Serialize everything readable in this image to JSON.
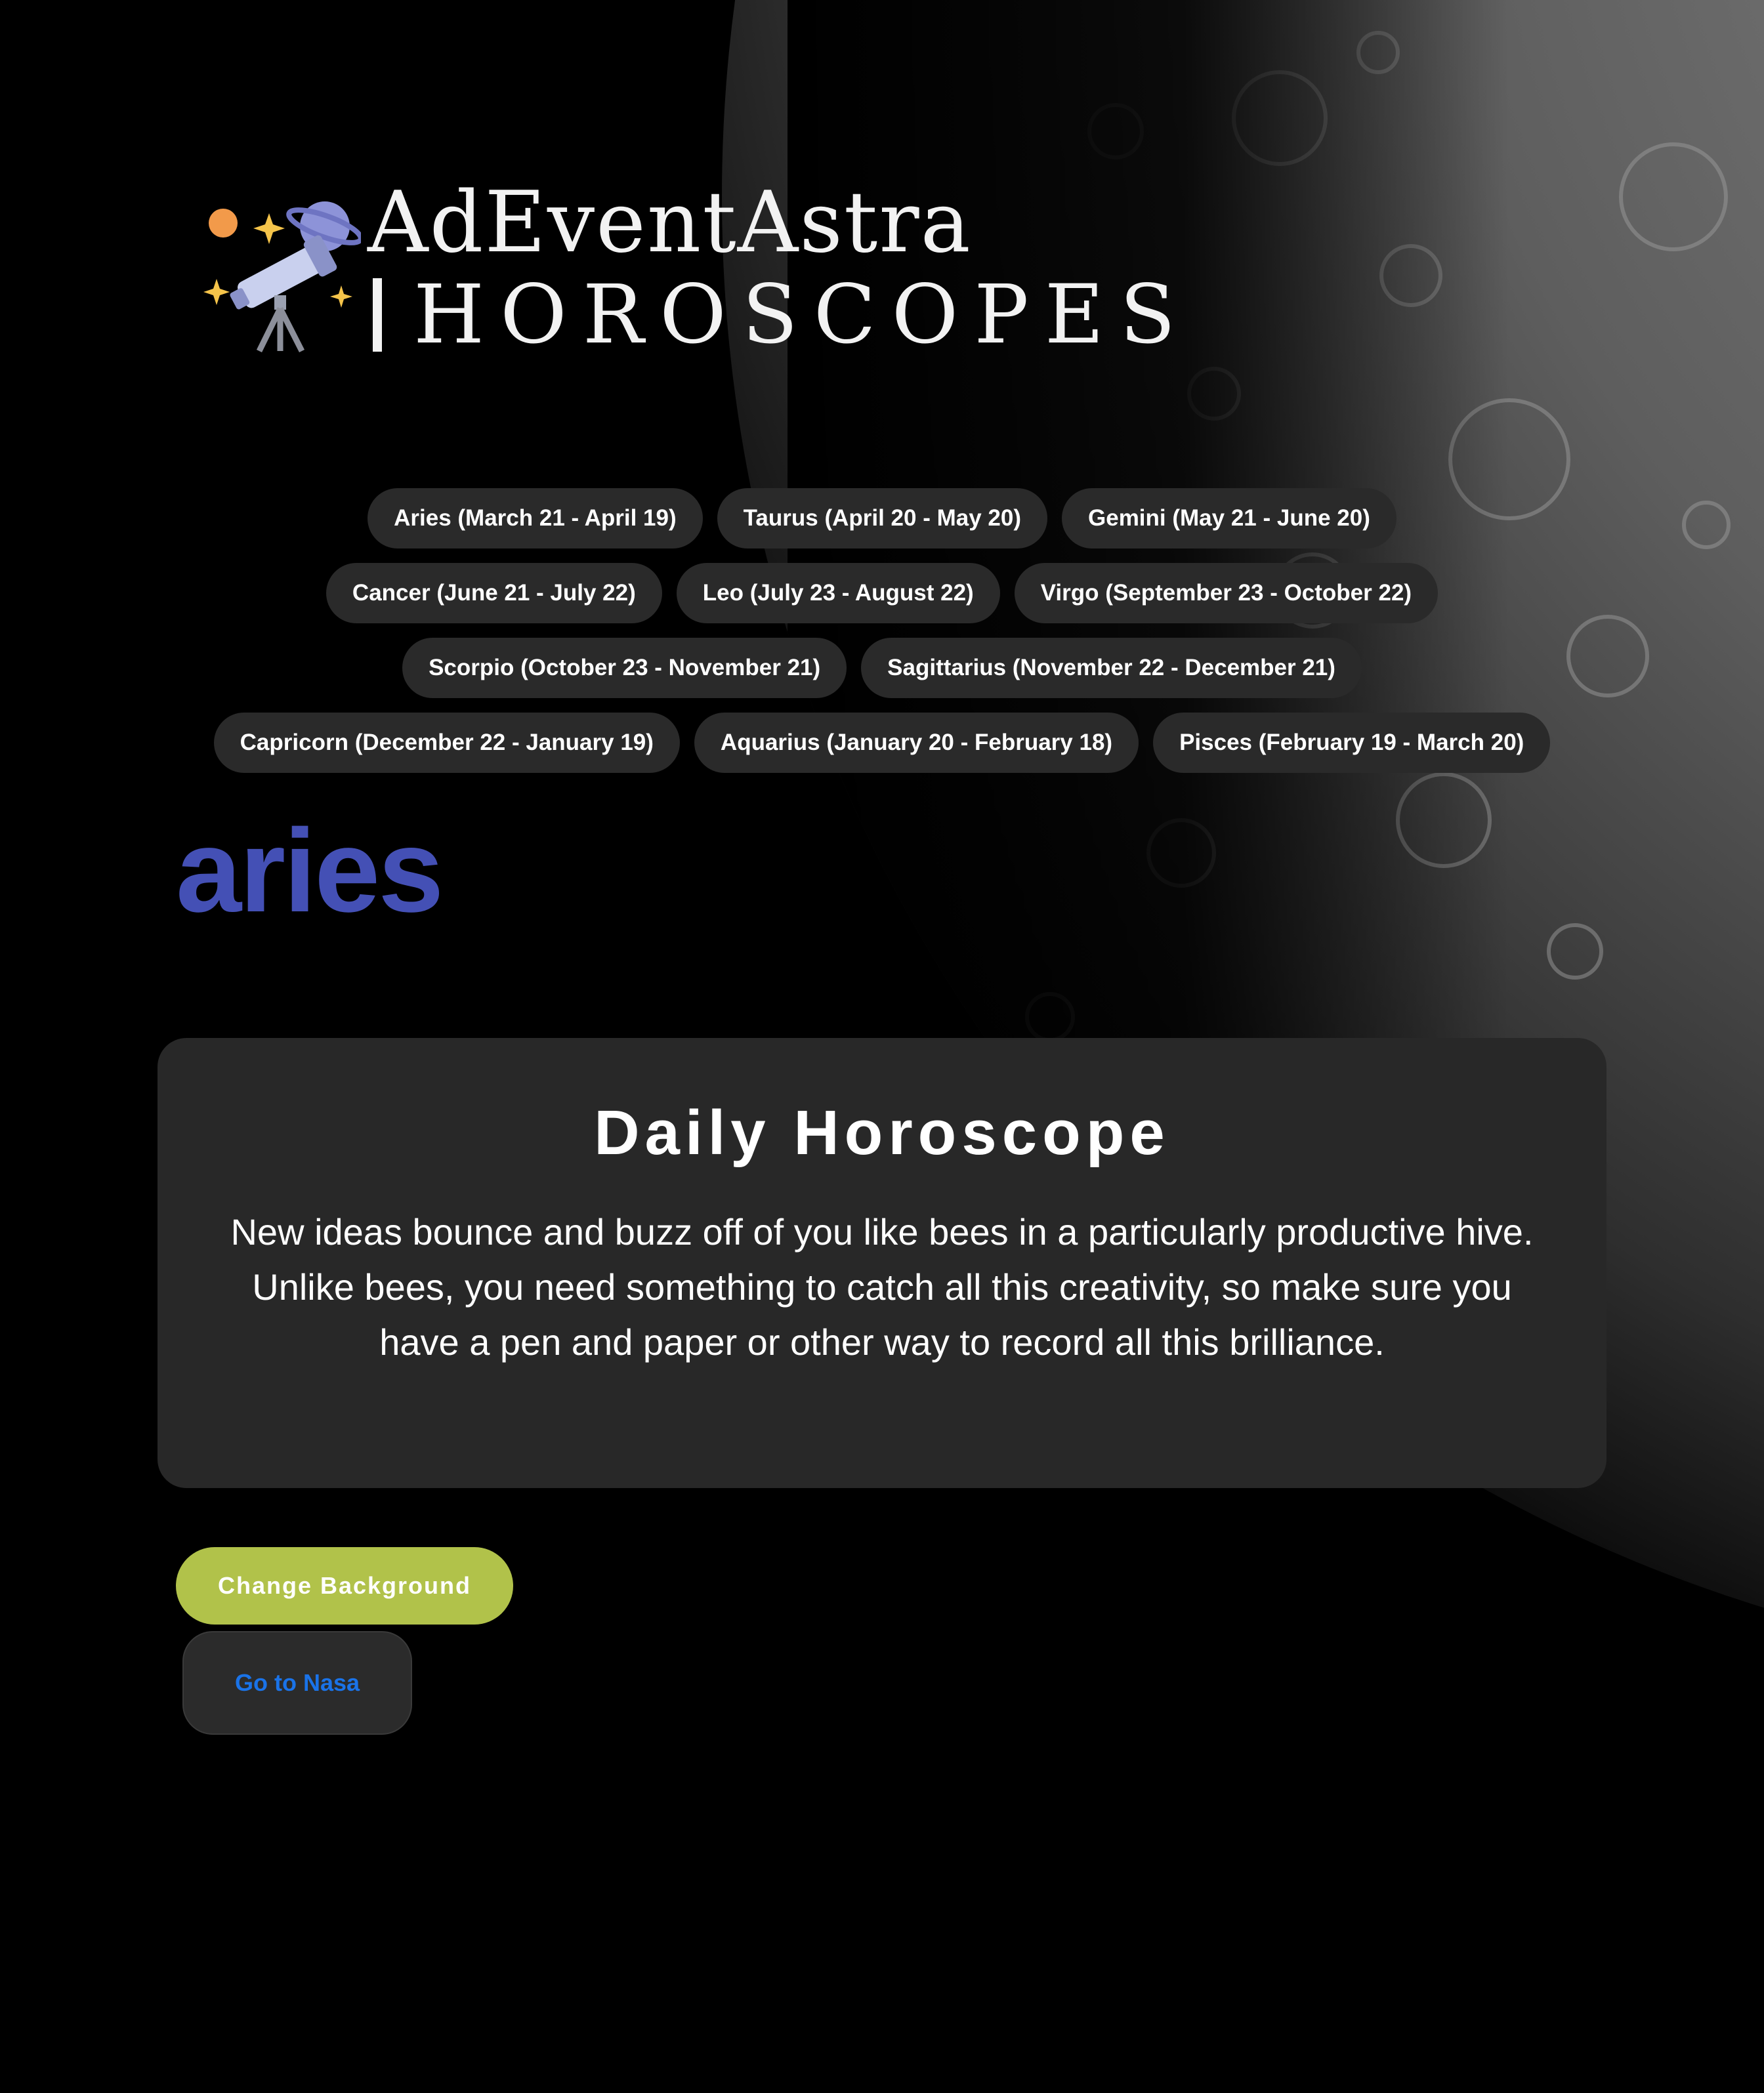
{
  "header": {
    "brand_name": "AdEventAstra",
    "brand_subtitle": "HOROSCOPES",
    "logo_icon": "telescope-icon"
  },
  "zodiac_signs": [
    [
      "Aries (March 21 - April 19)",
      "Taurus (April 20 - May 20)",
      "Gemini (May 21 - June 20)"
    ],
    [
      "Cancer (June 21 - July 22)",
      "Leo (July 23 - August 22)",
      "Virgo (September 23 - October 22)"
    ],
    [
      "Scorpio (October 23 - November 21)",
      "Sagittarius (November 22 - December 21)"
    ],
    [
      "Capricorn (December 22 - January 19)",
      "Aquarius (January 20 - February 18)",
      "Pisces (February 19 - March 20)"
    ]
  ],
  "selected_sign": "aries",
  "horoscope": {
    "title": "Daily Horoscope",
    "text": "New ideas bounce and buzz off of you like bees in a particularly productive hive. Unlike bees, you need something to catch all this creativity, so make sure you have a pen and paper or other way to record all this brilliance."
  },
  "buttons": {
    "change_background": "Change Background",
    "go_to_nasa": "Go to Nasa"
  },
  "colors": {
    "page_background": "#000000",
    "sign_title": "#4450b5",
    "sign_button": "#2a2a2a",
    "card_background": "#282828",
    "change_background_button": "#b1c24a",
    "nasa_link": "#1a73e8"
  }
}
